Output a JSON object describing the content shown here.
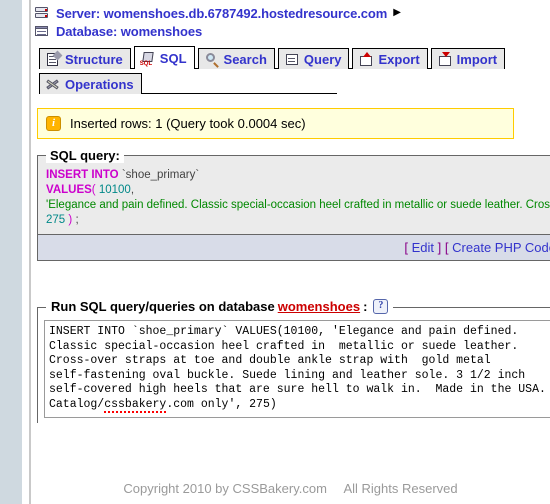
{
  "header": {
    "server_label": "Server: womenshoes.db.6787492.hostedresource.com",
    "server_arrow": "▶",
    "database_label": "Database: womenshoes"
  },
  "tabs": {
    "row1": [
      {
        "label": "Structure",
        "icon": "structure-icon",
        "active": false
      },
      {
        "label": "SQL",
        "icon": "sql-icon",
        "active": true
      },
      {
        "label": "Search",
        "icon": "search-icon",
        "active": false
      },
      {
        "label": "Query",
        "icon": "query-icon",
        "active": false
      },
      {
        "label": "Export",
        "icon": "export-icon",
        "active": false
      },
      {
        "label": "Import",
        "icon": "import-icon",
        "active": false
      }
    ],
    "row2": [
      {
        "label": "Operations",
        "icon": "operations-icon",
        "active": false
      }
    ]
  },
  "notice": {
    "icon": "info-icon",
    "text": "Inserted rows: 1 (Query took 0.0004 sec)"
  },
  "sql_query_panel": {
    "legend": "SQL query:",
    "tokens": {
      "kw_insert": "INSERT INTO",
      "identifier": "`shoe_primary`",
      "kw_values": "VALUES",
      "paren_open": "(",
      "number_id": "10100",
      "comma": ",",
      "string_literal": "'Elegance and pain defined. Classic special-occasion heel crafted in  metallic or suede leather. Cross-over",
      "number_price": "275",
      "paren_close": ")",
      "semicolon": ";"
    },
    "actions": {
      "bracket_open": "[",
      "bracket_close": "]",
      "edit_label": "Edit",
      "php_label": "Create PHP Code"
    }
  },
  "run_query_panel": {
    "legend_prefix": "Run SQL query/queries on database",
    "database_name": "womenshoes",
    "legend_suffix": ":",
    "help_icon": "help-icon",
    "textarea_line1": "INSERT INTO `shoe_primary` VALUES(10100, 'Elegance and pain defined.",
    "textarea_line2": "Classic special-occasion heel crafted in  metallic or suede leather.",
    "textarea_line3": "Cross-over straps at toe and double ankle strap with  gold metal",
    "textarea_line4": "self-fastening oval buckle. Suede lining and leather sole. 3 1/2 inch",
    "textarea_line5": "self-covered high heels that are sure hell to walk in.  Made in the USA.",
    "textarea_line6_pre": "Catalog/",
    "textarea_line6_misspelled": "cssbakery",
    "textarea_line6_post": ".com only', 275)"
  },
  "footer": {
    "copyright": "Copyright 2010 by CSSBakery.com",
    "rights": "All Rights Reserved"
  }
}
